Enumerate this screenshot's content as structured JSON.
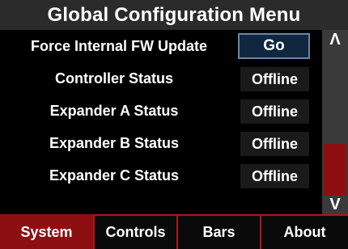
{
  "header": {
    "title": "Global Configuration Menu"
  },
  "rows": [
    {
      "label": "Force Internal FW Update",
      "value": "Go"
    },
    {
      "label": "Controller Status",
      "value": "Offline"
    },
    {
      "label": "Expander A Status",
      "value": "Offline"
    },
    {
      "label": "Expander B Status",
      "value": "Offline"
    },
    {
      "label": "Expander C Status",
      "value": "Offline"
    }
  ],
  "scrollbar": {
    "up_glyph": "Λ",
    "down_glyph": "V"
  },
  "tabs": [
    {
      "label": "System",
      "active": true
    },
    {
      "label": "Controls",
      "active": false
    },
    {
      "label": "Bars",
      "active": false
    },
    {
      "label": "About",
      "active": false
    }
  ],
  "colors": {
    "accent_red": "#8e0f12",
    "tab_border_red": "#b3141b",
    "title_bar": "#2b2b2b",
    "button_border": "#6a86a6",
    "button_fill": "#10273f"
  }
}
